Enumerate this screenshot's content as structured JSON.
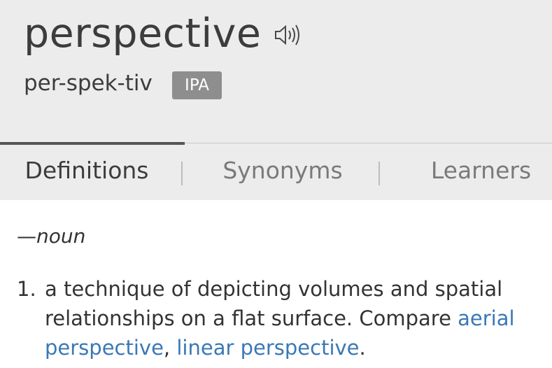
{
  "entry": {
    "word": "perspective",
    "pronunciation": "per-spek-tiv",
    "ipa_label": "IPA",
    "audio_icon": "speaker-icon"
  },
  "tabs": [
    {
      "label": "Definitions",
      "active": true
    },
    {
      "label": "Synonyms",
      "active": false
    },
    {
      "label": "Learners",
      "active": false
    }
  ],
  "definitions": {
    "part_of_speech": "—noun",
    "items": [
      {
        "number": "1.",
        "text": "a technique of depicting volumes and spatial relationships on a flat surface. Compare ",
        "links": [
          "aerial perspective",
          "linear perspective"
        ],
        "separator": ", ",
        "end": "."
      }
    ]
  },
  "colors": {
    "header_bg": "#ececec",
    "link": "#3a78b5",
    "badge_bg": "#8e8e8e"
  }
}
